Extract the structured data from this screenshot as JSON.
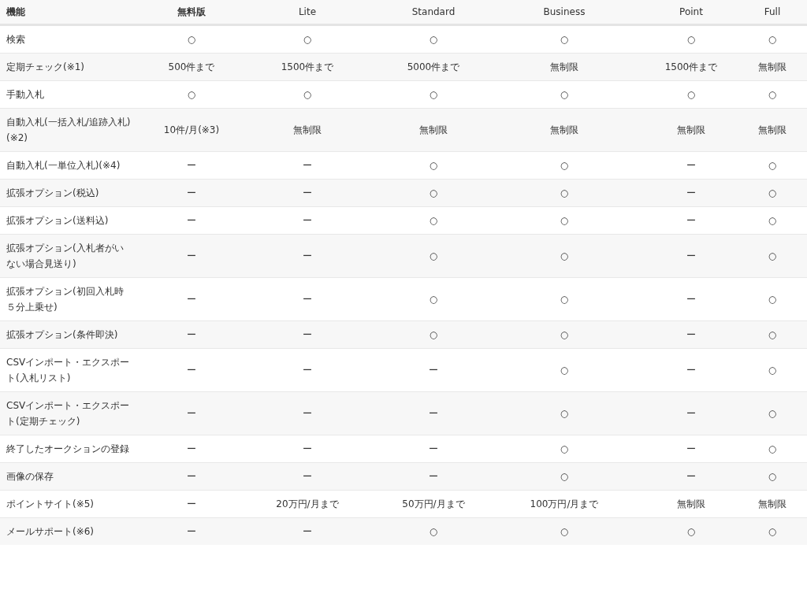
{
  "table": {
    "columns": [
      {
        "label": "機能",
        "bold": true
      },
      {
        "label": "無料版",
        "bold": true
      },
      {
        "label": "Lite",
        "bold": false
      },
      {
        "label": "Standard",
        "bold": false
      },
      {
        "label": "Business",
        "bold": false
      },
      {
        "label": "Point",
        "bold": false
      },
      {
        "label": "Full",
        "bold": false
      }
    ],
    "rows": [
      {
        "cells": [
          "検索",
          "○",
          "○",
          "○",
          "○",
          "○",
          "○"
        ]
      },
      {
        "cells": [
          "定期チェック(※1)",
          "500件まで",
          "1500件まで",
          "5000件まで",
          "無制限",
          "1500件まで",
          "無制限"
        ]
      },
      {
        "cells": [
          "手動入札",
          "○",
          "○",
          "○",
          "○",
          "○",
          "○"
        ]
      },
      {
        "cells": [
          "自動入札(一括入札/追跡入札)(※2)",
          "10件/月(※3)",
          "無制限",
          "無制限",
          "無制限",
          "無制限",
          "無制限"
        ]
      },
      {
        "cells": [
          "自動入札(一単位入札)(※4)",
          "ー",
          "ー",
          "○",
          "○",
          "ー",
          "○"
        ]
      },
      {
        "cells": [
          "拡張オプション(税込)",
          "ー",
          "ー",
          "○",
          "○",
          "ー",
          "○"
        ]
      },
      {
        "cells": [
          "拡張オプション(送料込)",
          "ー",
          "ー",
          "○",
          "○",
          "ー",
          "○"
        ]
      },
      {
        "cells": [
          "拡張オプション(入札者がいない場合見送り)",
          "ー",
          "ー",
          "○",
          "○",
          "ー",
          "○"
        ]
      },
      {
        "cells": [
          "拡張オプション(初回入札時５分上乗せ)",
          "ー",
          "ー",
          "○",
          "○",
          "ー",
          "○"
        ]
      },
      {
        "cells": [
          "拡張オプション(条件即決)",
          "ー",
          "ー",
          "○",
          "○",
          "ー",
          "○"
        ]
      },
      {
        "cells": [
          "CSVインポート・エクスポート(入札リスト)",
          "ー",
          "ー",
          "ー",
          "○",
          "ー",
          "○"
        ]
      },
      {
        "cells": [
          "CSVインポート・エクスポート(定期チェック)",
          "ー",
          "ー",
          "ー",
          "○",
          "ー",
          "○"
        ]
      },
      {
        "cells": [
          "終了したオークションの登録",
          "ー",
          "ー",
          "ー",
          "○",
          "ー",
          "○"
        ]
      },
      {
        "cells": [
          "画像の保存",
          "ー",
          "ー",
          "ー",
          "○",
          "ー",
          "○"
        ]
      },
      {
        "cells": [
          "ポイントサイト(※5)",
          "ー",
          "20万円/月まで",
          "50万円/月まで",
          "100万円/月まで",
          "無制限",
          "無制限"
        ]
      },
      {
        "cells": [
          "メールサポート(※6)",
          "ー",
          "ー",
          "○",
          "○",
          "○",
          "○"
        ]
      }
    ]
  }
}
